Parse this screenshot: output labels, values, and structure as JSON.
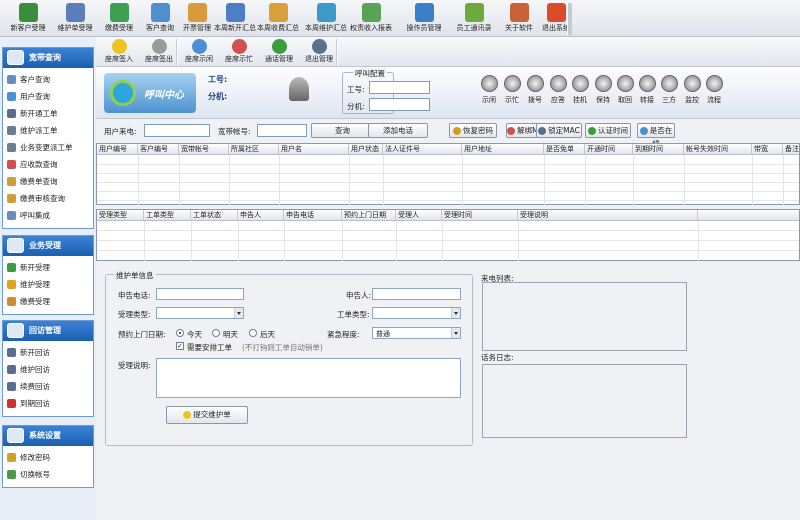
{
  "toolbar": [
    {
      "label": "新客户受理",
      "icon": "add-user-icon",
      "color": "#3a8f3a"
    },
    {
      "label": "维护单受理",
      "icon": "maintenance-icon",
      "color": "#5b7fb8"
    },
    {
      "label": "缴费受理",
      "icon": "payment-icon",
      "color": "#3d9f4f"
    },
    {
      "label": "客户查询",
      "icon": "customer-search-icon",
      "color": "#4f8fd0"
    },
    {
      "label": "开票管理",
      "icon": "invoice-icon",
      "color": "#d89a3a"
    },
    {
      "label": "本周新开汇总",
      "icon": "new-summary-icon",
      "color": "#4e7fc6"
    },
    {
      "label": "本周收费汇总",
      "icon": "fee-summary-icon",
      "color": "#d9a13b"
    },
    {
      "label": "本周维护汇总",
      "icon": "maint-summary-icon",
      "color": "#3b9ac8"
    },
    {
      "label": "权责收入报表",
      "icon": "income-report-icon",
      "color": "#5aa356"
    },
    {
      "label": "操作员管理",
      "icon": "operator-icon",
      "color": "#3b7fc9"
    },
    {
      "label": "员工通讯录",
      "icon": "contacts-icon",
      "color": "#6caa3e"
    },
    {
      "label": "关于软件",
      "icon": "home-icon",
      "color": "#c9623b"
    },
    {
      "label": "退出系统",
      "icon": "power-icon",
      "color": "#d94b2b"
    }
  ],
  "sidebar": {
    "groups": [
      {
        "title": "宽带查询",
        "icon": "globe-icon",
        "items": [
          {
            "label": "客户查询",
            "icon": "list-icon",
            "color": "#6a8bc0"
          },
          {
            "label": "用户查询",
            "icon": "user-icon",
            "color": "#4b8fd6"
          },
          {
            "label": "新开通工单",
            "icon": "doc-icon",
            "color": "#5a6f8f"
          },
          {
            "label": "维护派工单",
            "icon": "wrench-icon",
            "color": "#6b7c95"
          },
          {
            "label": "业务变更派工单",
            "icon": "change-icon",
            "color": "#6b7c95"
          },
          {
            "label": "应收款查询",
            "icon": "receivable-icon",
            "color": "#d05050"
          },
          {
            "label": "缴费单查询",
            "icon": "bill-icon",
            "color": "#d09b3a"
          },
          {
            "label": "缴费审核查询",
            "icon": "audit-icon",
            "color": "#d09b3a"
          },
          {
            "label": "呼叫集成",
            "icon": "phone-icon",
            "color": "#6a8bc0"
          }
        ]
      },
      {
        "title": "业务受理",
        "icon": "chat-icon",
        "items": [
          {
            "label": "新开受理",
            "icon": "plus-icon",
            "color": "#3a9f3a"
          },
          {
            "label": "维护受理",
            "icon": "smile-icon",
            "color": "#e0a020"
          },
          {
            "label": "缴费受理",
            "icon": "coin-icon",
            "color": "#d08a30"
          }
        ]
      },
      {
        "title": "回访管理",
        "icon": "mail-icon",
        "items": [
          {
            "label": "新开回访",
            "icon": "table-icon",
            "color": "#5a6f8f"
          },
          {
            "label": "维护回访",
            "icon": "table-icon",
            "color": "#5a6f8f"
          },
          {
            "label": "续费回访",
            "icon": "table-icon",
            "color": "#5a6f8f"
          },
          {
            "label": "到期回访",
            "icon": "heart-icon",
            "color": "#d03030"
          }
        ]
      },
      {
        "title": "系统设置",
        "icon": "settings-icon",
        "items": [
          {
            "label": "修改密码",
            "icon": "key-icon",
            "color": "#d0a020"
          },
          {
            "label": "切换帐号",
            "icon": "switch-icon",
            "color": "#4a9a4a"
          }
        ]
      }
    ]
  },
  "subtoolbar": [
    {
      "label": "座席签入",
      "icon": "smile-icon",
      "color": "#f0c420"
    },
    {
      "label": "座席签出",
      "icon": "record-icon",
      "color": "#9a9a9a"
    },
    {
      "label": "座席示闲",
      "icon": "user-idle-icon",
      "color": "#4b8fd6"
    },
    {
      "label": "座席示忙",
      "icon": "user-busy-icon",
      "color": "#d05050"
    },
    {
      "label": "通话管理",
      "icon": "call-manage-icon",
      "color": "#3a9f3a"
    },
    {
      "label": "退出管理",
      "icon": "exit-manage-icon",
      "color": "#5a6f8f"
    }
  ],
  "header": {
    "logo_text": "呼叫中心",
    "agent_id_label": "工号:",
    "extension_label": "分机:",
    "call_config": {
      "title": "呼叫配置",
      "agent_id_label": "工号:",
      "extension_label": "分机:"
    },
    "phone_buttons": [
      "示闲",
      "示忙",
      "拨号",
      "应答",
      "挂机",
      "保持",
      "取回",
      "转接",
      "三方",
      "监控",
      "流程"
    ]
  },
  "search": {
    "caller_label": "用户来电:",
    "account_label": "宽带帐号:",
    "query_button": "查询",
    "add_call_button": "添加电话",
    "actions": [
      "恢复密码",
      "解绑MAC",
      "锁定MAC",
      "认证时间",
      "是否在线"
    ]
  },
  "user_grid": {
    "columns": [
      "用户编号",
      "客户编号",
      "宽带帐号",
      "所属社区",
      "用户名",
      "用户状态",
      "法人证件号",
      "用户地址",
      "是否免单",
      "开通时间",
      "到期时间",
      "帐号失效时间",
      "带宽",
      "备注"
    ]
  },
  "order_grid": {
    "columns": [
      "受理类型",
      "工单类型",
      "工单状态",
      "申告人",
      "申告电话",
      "预约上门日期",
      "受理人",
      "受理时间",
      "受理说明"
    ]
  },
  "maintenance": {
    "title": "维护单信息",
    "phone_label": "申告电话:",
    "reporter_label": "申告人:",
    "accept_type_label": "受理类型:",
    "order_type_label": "工单类型:",
    "date_label": "预约上门日期:",
    "date_options": [
      "今天",
      "明天",
      "后天"
    ],
    "selected_date": "今天",
    "urgency_label": "紧急程度:",
    "urgency_value": "普通",
    "need_dispatch_label": "需要安排工单",
    "need_dispatch_checked": "✓",
    "dispatch_hint": "(不打钩则工单自动销单)",
    "desc_label": "受理说明:",
    "submit_button": "提交维护单"
  },
  "call_list_label": "来电列表:",
  "call_log_label": "话务日志:"
}
